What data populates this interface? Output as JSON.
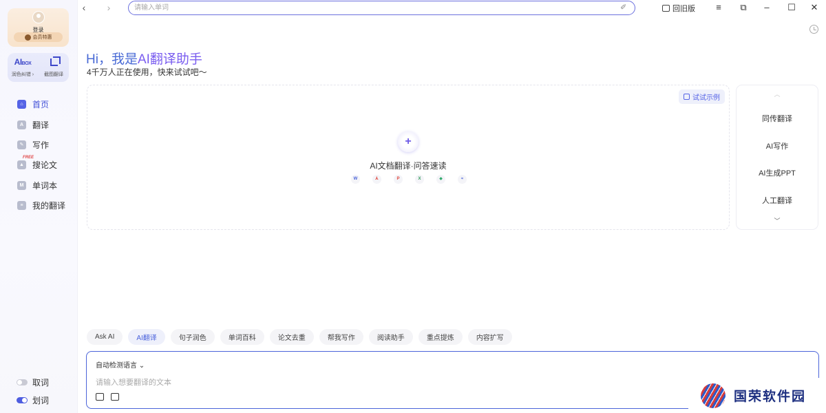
{
  "sidebar": {
    "login_label": "登录",
    "vip_label": "会员特惠",
    "aibox": {
      "logo_main": "AI",
      "logo_small": "BOX",
      "left_label": "润色纠错 ›",
      "right_label": "截图翻译"
    },
    "nav": [
      {
        "label": "首页",
        "icon": "home-icon",
        "active": true
      },
      {
        "label": "翻译",
        "icon": "translate-icon",
        "active": false
      },
      {
        "label": "写作",
        "icon": "pen-icon",
        "active": false
      },
      {
        "label": "搜论文",
        "icon": "paper-icon",
        "active": false,
        "tag": "FREE"
      },
      {
        "label": "单词本",
        "icon": "book-icon",
        "active": false
      },
      {
        "label": "我的翻译",
        "icon": "doc-icon",
        "active": false
      }
    ],
    "toggles": [
      {
        "label": "取词",
        "on": false
      },
      {
        "label": "划词",
        "on": true
      }
    ]
  },
  "topbar": {
    "search_placeholder": "请输入单词",
    "old_version_label": "回旧版"
  },
  "main": {
    "greeting_prefix": "Hi，我是",
    "greeting_ai": "AI翻译助手",
    "subtitle": "4千万人正在使用，快来试试吧～",
    "try_example": "试试示例",
    "upload_title": "AI文档翻译·问答速读",
    "file_types": [
      {
        "glyph": "W",
        "color": "#4a63d9"
      },
      {
        "glyph": "⅄",
        "color": "#e0453a"
      },
      {
        "glyph": "P",
        "color": "#e0453a"
      },
      {
        "glyph": "X",
        "color": "#2f9a57"
      },
      {
        "glyph": "◆",
        "color": "#2fa86a"
      },
      {
        "glyph": "≈",
        "color": "#4a63d9"
      }
    ]
  },
  "right_panel": {
    "items": [
      "同传翻译",
      "AI写作",
      "AI生成PPT",
      "人工翻译"
    ]
  },
  "tabs": [
    {
      "label": "Ask AI",
      "active": false
    },
    {
      "label": "AI翻译",
      "active": true
    },
    {
      "label": "句子润色",
      "active": false
    },
    {
      "label": "单词百科",
      "active": false
    },
    {
      "label": "论文去重",
      "active": false
    },
    {
      "label": "帮我写作",
      "active": false
    },
    {
      "label": "阅读助手",
      "active": false
    },
    {
      "label": "重点提炼",
      "active": false
    },
    {
      "label": "内容扩写",
      "active": false
    }
  ],
  "input": {
    "language": "自动检测语言",
    "placeholder": "请输入想要翻译的文本"
  },
  "watermark": "国荣软件园",
  "colors": {
    "accent": "#4a63d9",
    "ai_purple": "#7a5df0"
  }
}
